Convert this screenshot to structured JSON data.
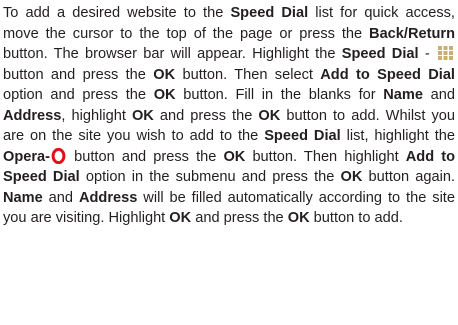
{
  "paragraph": {
    "s1_a": "To add a desired website to the ",
    "s1_b": "Speed Dial",
    "s1_c": " list for quick access, move the cursor to the top of the page or press the ",
    "s1_d": "Back/Return",
    "s1_e": " button. The browser bar will appear. Highlight the ",
    "s1_f": "Speed Dial",
    "s1_g": " - ",
    "s1_h": " button and press the ",
    "s1_i": "OK",
    "s1_j": " button. Then select ",
    "s1_k": "Add to Speed Dial",
    "s1_l": " option and press the ",
    "s1_m": "OK",
    "s1_n": " button. Fill in the blanks for ",
    "s1_o": "Name",
    "s1_p": " and ",
    "s1_q": "Address",
    "s1_r": ", highlight ",
    "s1_s": "OK",
    "s1_t": " and press the ",
    "s1_u": "OK",
    "s1_v": " button to add. Whilst you are on the site you wish to add to the ",
    "s1_w": "Speed Dial",
    "s1_x": " list, highlight the ",
    "s1_y": "Opera-",
    "s1_z": " button and press the ",
    "s2_a": "OK",
    "s2_b": " button. Then highlight ",
    "s2_c": "Add to Speed Dial",
    "s2_d": " option in the submenu and press the ",
    "s2_e": "OK",
    "s2_f": " button again. ",
    "s2_g": "Name",
    "s2_h": " and ",
    "s2_i": "Address",
    "s2_j": " will be filled automatically according to the site you are visiting. Highlight ",
    "s2_k": "OK",
    "s2_l": " and press the ",
    "s2_m": "OK",
    "s2_n": " button to add."
  },
  "icons": {
    "speed_dial": "speed-dial-icon",
    "opera": "opera-icon"
  },
  "colors": {
    "text": "#231f20",
    "speed_dial_icon": "#c8b070",
    "opera_icon": "#e0101a"
  }
}
